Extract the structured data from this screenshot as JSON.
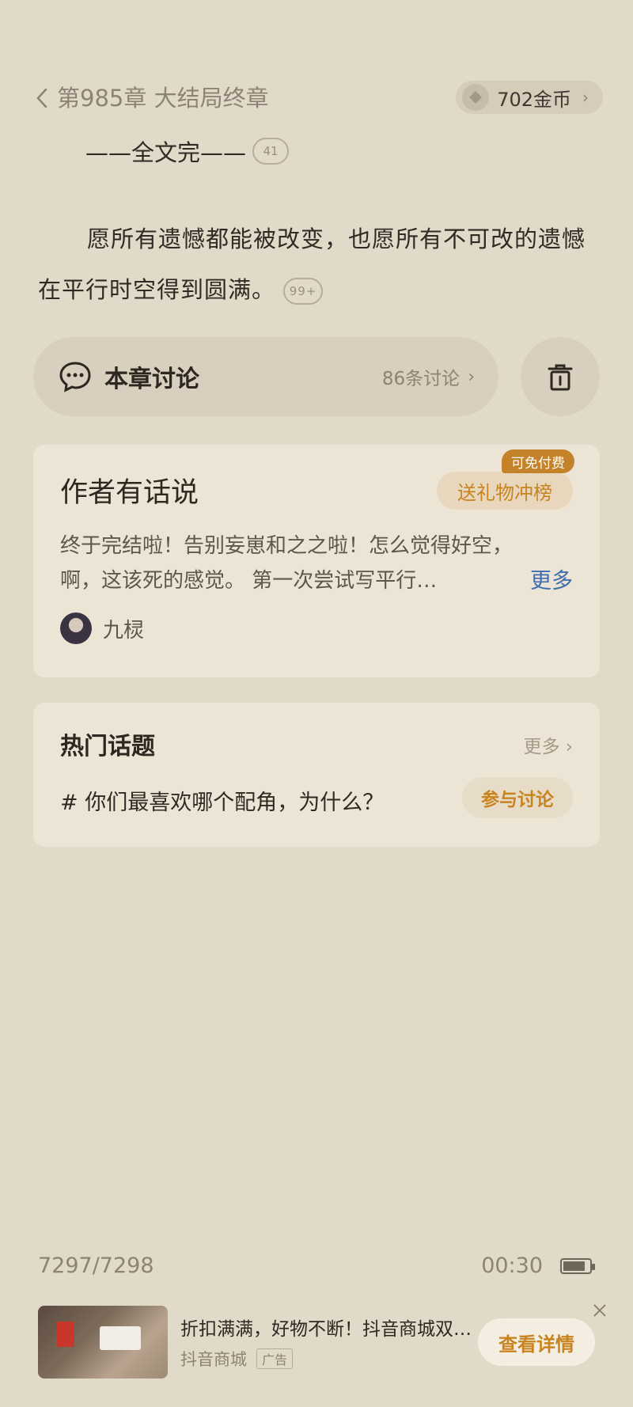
{
  "header": {
    "chapter_title": "第985章 大结局终章",
    "coins": "702金币"
  },
  "content": {
    "end_marker": "——全文完——",
    "end_comment_count": "41",
    "paragraph": "愿所有遗憾都能被改变，也愿所有不可改的遗憾在平行时空得到圆满。",
    "paragraph_comment_count": "99+"
  },
  "discussion": {
    "label": "本章讨论",
    "count": "86条讨论"
  },
  "author_note": {
    "title": "作者有话说",
    "gift_button": "送礼物冲榜",
    "free_badge": "可免付费",
    "text": "终于完结啦！告别妄崽和之之啦！怎么觉得好空，啊，这该死的感觉。 第一次尝试写平行…",
    "more": "更多",
    "author_name": "九棂"
  },
  "hot_topics": {
    "title": "热门话题",
    "more": "更多",
    "topic": "# 你们最喜欢哪个配角，为什么？",
    "join_button": "参与讨论"
  },
  "footer": {
    "progress": "7297/7298",
    "time": "00:30",
    "battery_level": 0.85
  },
  "ad": {
    "title": "折扣满满，好物不断！抖音商城双…",
    "source": "抖音商城",
    "tag": "广告",
    "button": "查看详情"
  },
  "colors": {
    "background": "#e2dac9",
    "accent": "#c8841e",
    "link": "#3f6cb2"
  }
}
